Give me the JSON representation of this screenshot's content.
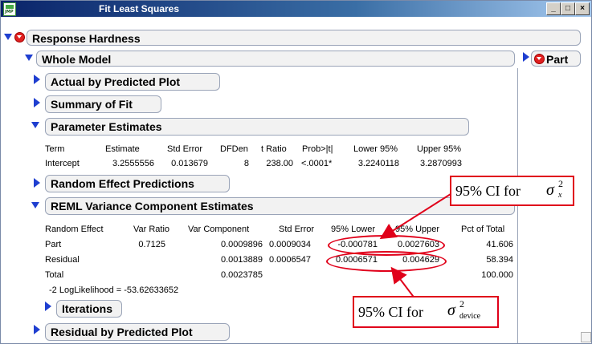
{
  "window": {
    "app_icon_label": "JMP",
    "title": "Fit Least Squares",
    "minimize": "_",
    "maximize": "□",
    "close": "×"
  },
  "report": {
    "response_title": "Response Hardness",
    "whole_model_title": "Whole Model",
    "part_label": "Part",
    "actual_by_predicted": "Actual by Predicted Plot",
    "summary_of_fit": "Summary of Fit",
    "parameter_estimates": {
      "title": "Parameter Estimates",
      "headers": [
        "Term",
        "Estimate",
        "Std Error",
        "DFDen",
        "t Ratio",
        "Prob>|t|",
        "Lower 95%",
        "Upper 95%"
      ],
      "row": [
        "Intercept",
        "3.2555556",
        "0.013679",
        "8",
        "238.00",
        "<.0001*",
        "3.2240118",
        "3.2870993"
      ]
    },
    "random_effect_predictions": "Random Effect Predictions",
    "reml": {
      "title": "REML Variance Component Estimates",
      "headers": [
        "Random Effect",
        "Var Ratio",
        "Var Component",
        "Std Error",
        "95% Lower",
        "95% Upper",
        "Pct of Total"
      ],
      "rows": [
        [
          "Part",
          "0.7125",
          "0.0009896",
          "0.0009034",
          "-0.000781",
          "0.0027603",
          "41.606"
        ],
        [
          "Residual",
          "",
          "0.0013889",
          "0.0006547",
          "0.0006571",
          "0.004629",
          "58.394"
        ],
        [
          "Total",
          "",
          "0.0023785",
          "",
          "",
          "",
          "100.000"
        ]
      ],
      "loglik": "-2 LogLikelihood = -53.62633652"
    },
    "iterations": "Iterations",
    "residual_by_predicted": "Residual by Predicted Plot"
  },
  "annotations": {
    "ci_x": {
      "prefix": "95% CI for ",
      "symbol": "σ",
      "sup": "2",
      "sub": "x"
    },
    "ci_device": {
      "prefix": "95% CI for ",
      "symbol": "σ",
      "sup": "2",
      "sub": "device"
    }
  },
  "colors": {
    "title_bar": "#0a246a",
    "disclosure": "#1f3fd0",
    "red_menu": "#e02020",
    "annotation": "#e0001a"
  }
}
